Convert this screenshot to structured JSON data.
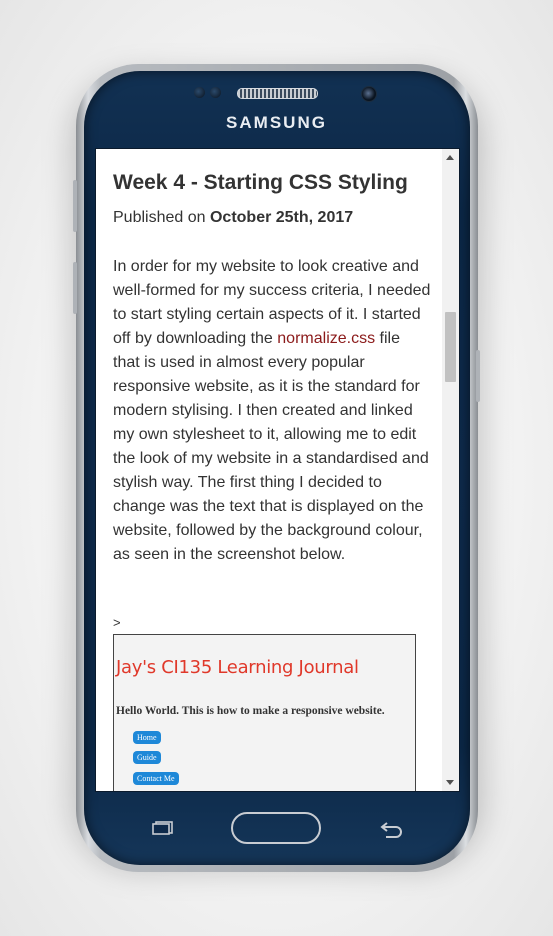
{
  "device": {
    "brand": "SAMSUNG"
  },
  "post": {
    "title": "Week 4 - Starting CSS Styling",
    "published_prefix": "Published on",
    "published_date": "October 25th, 2017",
    "body_before_link": "In order for my website to look creative and well-formed for my success criteria, I needed to start styling certain aspects of it. I started off by downloading the ",
    "link_text": "normalize.css",
    "body_after_link": " file that is used in almost every popular responsive website, as it is the standard for modern stylising. I then created and linked my own stylesheet to it, allowing me to edit the look of my website in a standardised and stylish way. The first thing I decided to change was the text that is displayed on the website, followed by the background colour, as seen in the screenshot below.",
    "stray_char": ">"
  },
  "screenshot": {
    "title": "Jay's CI135 Learning Journal",
    "hello": "Hello World. This is how to make a responsive website.",
    "buttons": [
      "Home",
      "Guide",
      "Contact Me"
    ]
  },
  "colors": {
    "link": "#8b1a1a",
    "journal_title": "#e0382a",
    "nav_button": "#1e88d8",
    "phone_body": "#0b2746"
  }
}
